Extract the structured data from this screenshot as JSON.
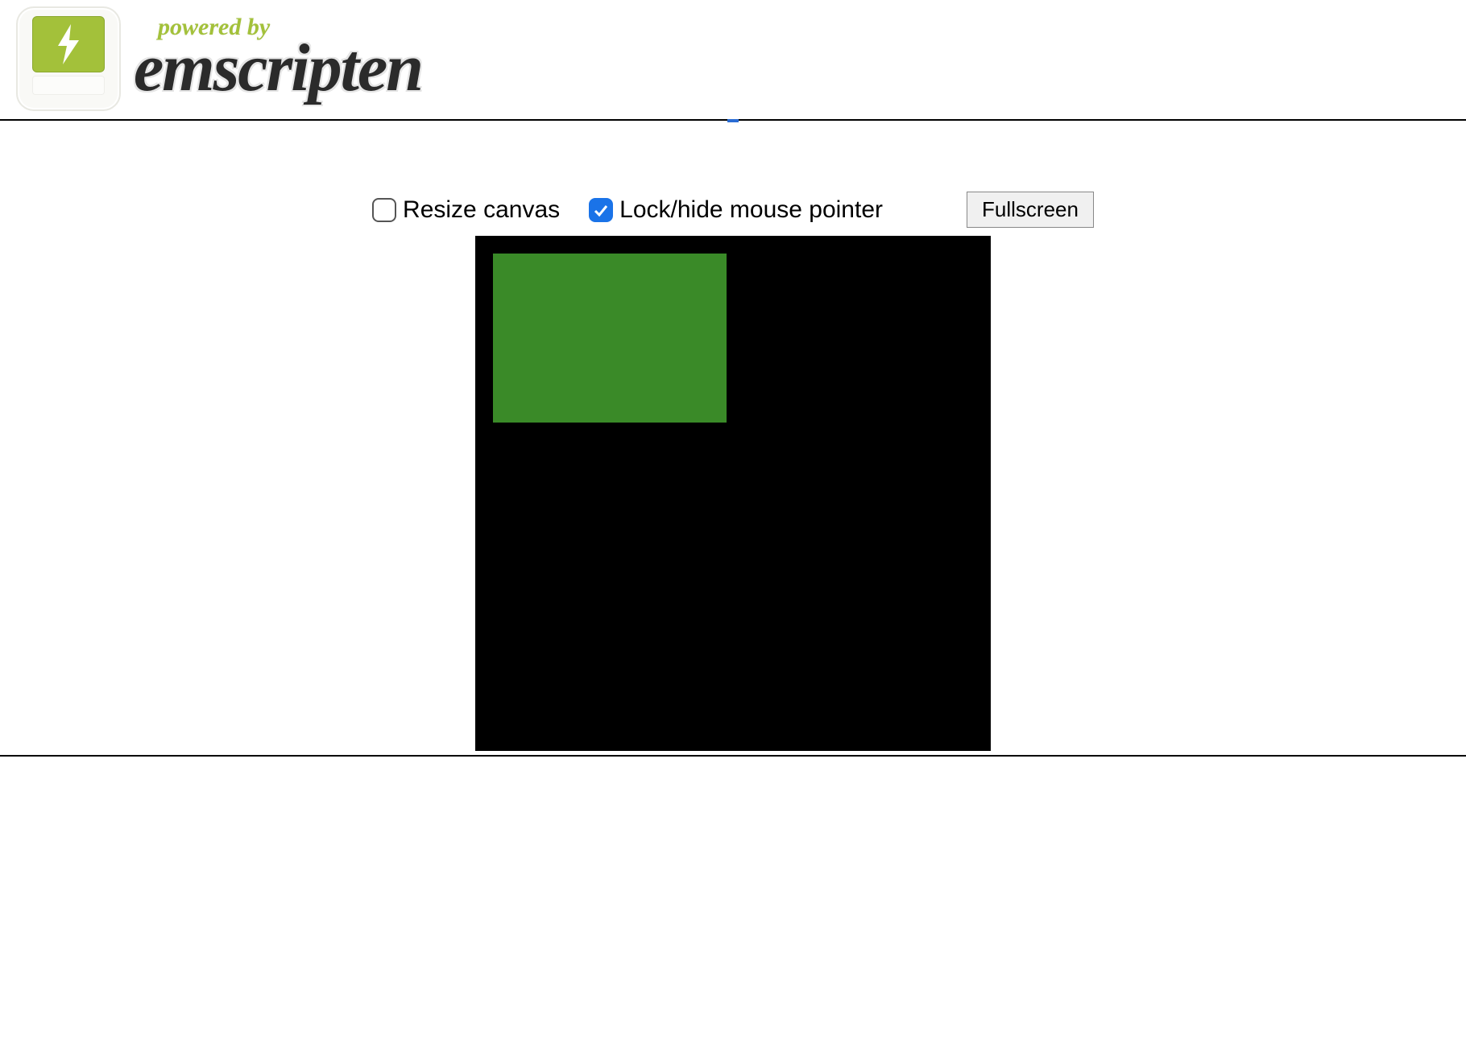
{
  "header": {
    "powered_by": "powered by",
    "title": "emscripten"
  },
  "controls": {
    "resize_label": "Resize canvas",
    "resize_checked": false,
    "lockhide_label": "Lock/hide mouse pointer",
    "lockhide_checked": true,
    "fullscreen_label": "Fullscreen"
  },
  "canvas": {
    "bg": "#000000",
    "rect_color": "#3a8a28"
  }
}
